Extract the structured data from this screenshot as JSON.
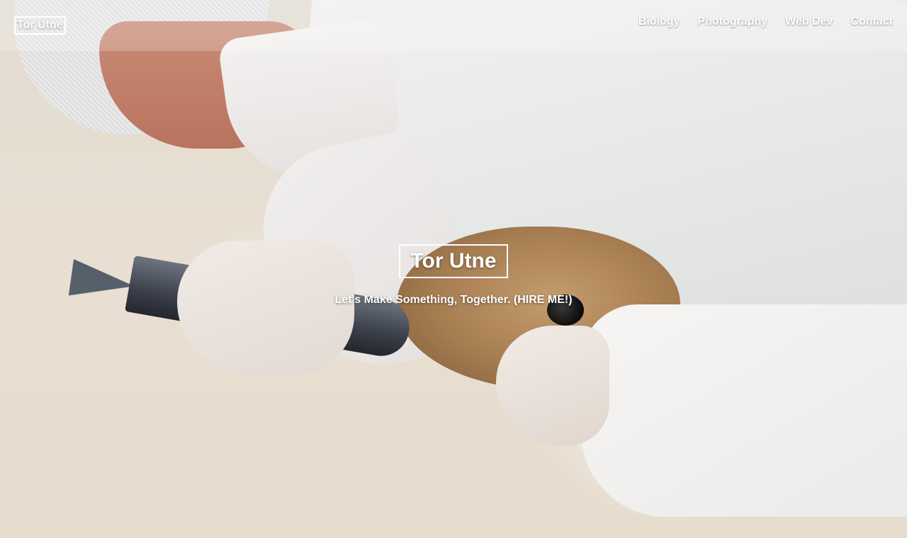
{
  "navbar": {
    "brand": "Tor Utne",
    "links": [
      "Biology",
      "Photography",
      "Web Dev",
      "Contact"
    ]
  },
  "hero": {
    "title": "Tor Utne",
    "tagline": "Let's Make Something, Together. (HIRE ME!)",
    "background_image": "photo-of-person-in-protective-suit-feeding-fish-to-seal"
  },
  "colors": {
    "nav_text": "#ffffff",
    "nav_bar_overlay": "rgba(255,255,255,0.22)"
  }
}
